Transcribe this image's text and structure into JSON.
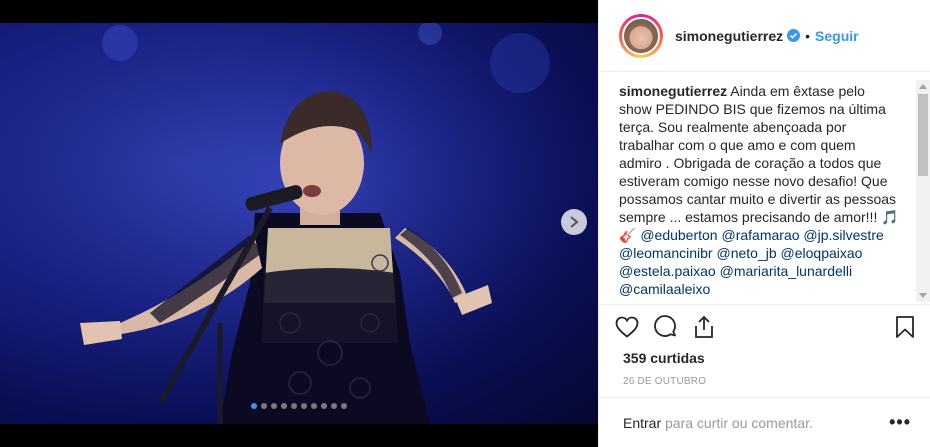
{
  "post": {
    "username": "simonegutierrez",
    "separator": "•",
    "follow_label": "Seguir",
    "caption_user": "simonegutierrez",
    "caption_text": "Ainda em êxtase pelo show PEDINDO BIS que fizemos na última terça. Sou realmente abençoada por trabalhar com o que amo e com quem admiro . Obrigada de coração a todos que estiveram comigo nesse novo desafio! Que possamos cantar muito e divertir as pessoas sempre ... estamos precisando de amor!!! 🎵🎸",
    "mentions": [
      "@eduberton",
      "@rafamarao",
      "@jp.silvestre",
      "@leomancinibr",
      "@neto_jb",
      "@eloqpaixao",
      "@estela.paixao",
      "@mariarita_lunardelli",
      "@camilaaleixo"
    ],
    "likes": "359 curtidas",
    "date": "26 DE OUTUBRO",
    "login_text": "Entrar",
    "login_rest": " para curtir ou comentar.",
    "more_label": "•••"
  },
  "carousel": {
    "total": 10,
    "active_index": 0
  },
  "icons": [
    "verified-badge-icon",
    "heart-icon",
    "comment-icon",
    "share-icon",
    "bookmark-icon",
    "chevron-right-icon"
  ],
  "colors": {
    "accent": "#3897f0",
    "mention": "#003569",
    "muted": "#999999",
    "stage_blue": "#1a2388"
  }
}
